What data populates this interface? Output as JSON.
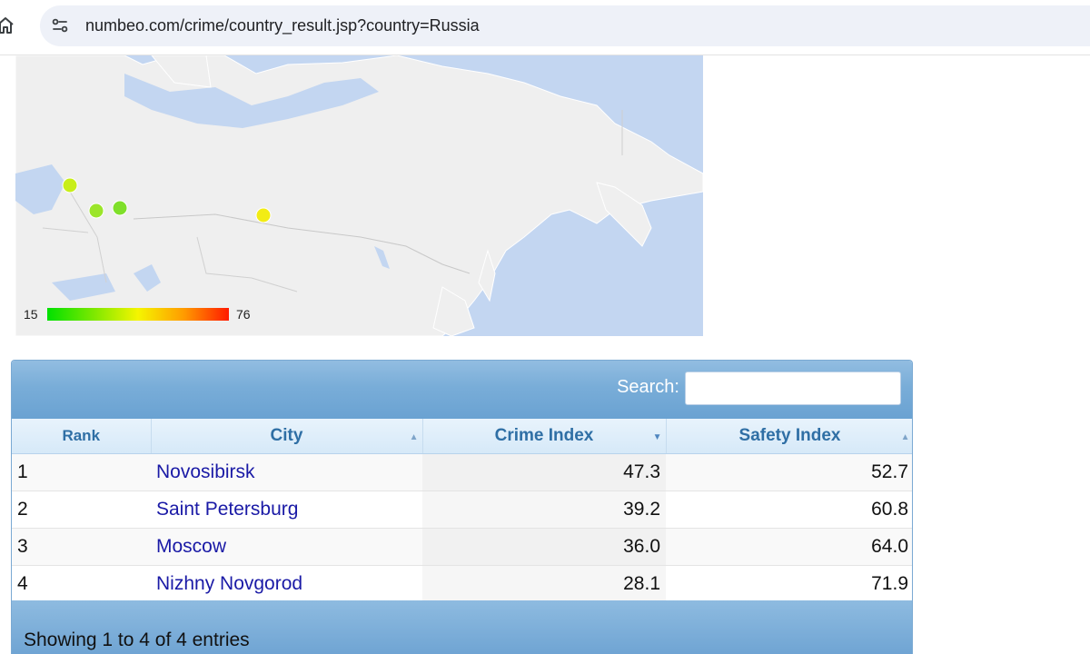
{
  "browser": {
    "url": "numbeo.com/crime/country_result.jsp?country=Russia"
  },
  "map": {
    "legend_min": "15",
    "legend_max": "76",
    "markers": [
      {
        "city": "Saint Petersburg",
        "color": "#c8ee1a"
      },
      {
        "city": "Nizhny Novgorod",
        "color": "#9be52a"
      },
      {
        "city": "Moscow",
        "color": "#a6e82a"
      },
      {
        "city": "Novosibirsk",
        "color": "#f2ec14"
      }
    ]
  },
  "table": {
    "search_label": "Search:",
    "search_value": "",
    "columns": [
      "Rank",
      "City",
      "Crime Index",
      "Safety Index"
    ],
    "rows": [
      {
        "rank": "1",
        "city": "Novosibirsk",
        "crime": "47.3",
        "safety": "52.7"
      },
      {
        "rank": "2",
        "city": "Saint Petersburg",
        "crime": "39.2",
        "safety": "60.8"
      },
      {
        "rank": "3",
        "city": "Moscow",
        "crime": "36.0",
        "safety": "64.0"
      },
      {
        "rank": "4",
        "city": "Nizhny Novgorod",
        "crime": "28.1",
        "safety": "71.9"
      }
    ],
    "info": "Showing 1 to 4 of 4 entries"
  }
}
